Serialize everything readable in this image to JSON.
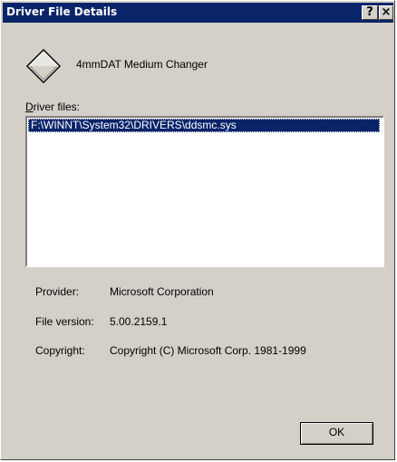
{
  "window": {
    "title": "Driver File Details",
    "help_button": "?",
    "close_button": "×"
  },
  "device": {
    "name": "4mmDAT Medium Changer",
    "icon": "diamond-device-icon"
  },
  "driver_files": {
    "label_mnemonic": "D",
    "label_rest": "river files:",
    "items": [
      "F:\\WINNT\\System32\\DRIVERS\\ddsmc.sys"
    ],
    "selected_index": 0
  },
  "properties": {
    "provider_label": "Provider:",
    "provider_value": "Microsoft Corporation",
    "version_label": "File version:",
    "version_value": "5.00.2159.1",
    "copyright_label": "Copyright:",
    "copyright_value": "Copyright (C) Microsoft Corp. 1981-1999"
  },
  "buttons": {
    "ok_label": "OK"
  },
  "colors": {
    "face": "#d4d0c8",
    "titlebar": "#0a246a",
    "selection": "#0a246a"
  }
}
